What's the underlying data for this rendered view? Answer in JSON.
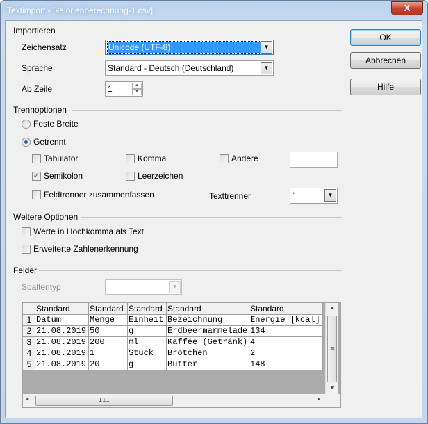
{
  "window": {
    "title": "Textimport - [kalorienberechnung-1.csv]",
    "close": "X"
  },
  "buttons": {
    "ok": "OK",
    "cancel": "Abbrechen",
    "help": "Hilfe"
  },
  "import": {
    "section": "Importieren",
    "charset_label": "Zeichensatz",
    "charset_value": "Unicode (UTF-8)",
    "language_label": "Sprache",
    "language_value": "Standard - Deutsch (Deutschland)",
    "from_row_label": "Ab Zeile",
    "from_row_value": "1"
  },
  "separator": {
    "section": "Trennoptionen",
    "fixed_width": "Feste Breite",
    "separated": "Getrennt",
    "selected": "Getrennt",
    "tab": "Tabulator",
    "tab_checked": false,
    "comma": "Komma",
    "comma_checked": false,
    "other": "Andere",
    "other_checked": false,
    "other_value": "",
    "semicolon": "Semikolon",
    "semicolon_checked": true,
    "space": "Leerzeichen",
    "space_checked": false,
    "merge": "Feldtrenner zusammenfassen",
    "merge_checked": false,
    "text_delimiter_label": "Texttrenner",
    "text_delimiter_value": "\""
  },
  "other_options": {
    "section": "Weitere Optionen",
    "quoted_as_text": "Werte in Hochkomma als Text",
    "detect_special": "Erweiterte Zahlenerkennung"
  },
  "fields": {
    "section": "Felder",
    "column_type_label": "Spaltentyp",
    "column_type_value": "",
    "headers": [
      "Standard",
      "Standard",
      "Standard",
      "Standard",
      "Standard"
    ],
    "rows": [
      {
        "n": "1",
        "cells": [
          "Datum",
          "Menge",
          "Einheit",
          "Bezeichnung",
          "Energie [kcal]"
        ]
      },
      {
        "n": "2",
        "cells": [
          "21.08.2019",
          "50",
          "g",
          "Erdbeermarmelade",
          "134"
        ]
      },
      {
        "n": "3",
        "cells": [
          "21.08.2019",
          "200",
          "ml",
          "Kaffee (Getränk)",
          "4"
        ]
      },
      {
        "n": "4",
        "cells": [
          "21.08.2019",
          "1",
          "Stück",
          "Brötchen",
          "2"
        ]
      },
      {
        "n": "5",
        "cells": [
          "21.08.2019",
          "20",
          "g",
          "Butter",
          "148"
        ]
      }
    ]
  },
  "colors": {
    "selection": "#3399ff",
    "dialog_bg": "#f0f0f0"
  }
}
